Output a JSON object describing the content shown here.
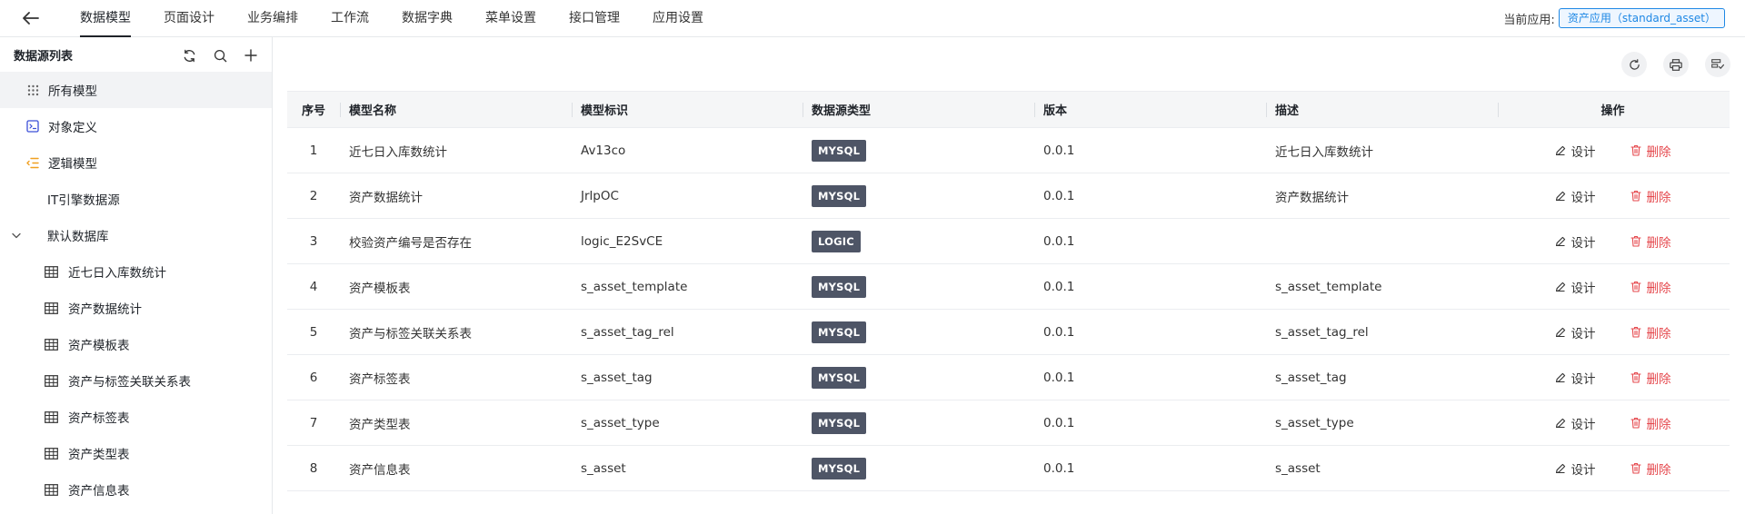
{
  "nav": {
    "tabs": [
      {
        "label": "数据模型",
        "active": true
      },
      {
        "label": "页面设计"
      },
      {
        "label": "业务编排"
      },
      {
        "label": "工作流"
      },
      {
        "label": "数据字典"
      },
      {
        "label": "菜单设置"
      },
      {
        "label": "接口管理"
      },
      {
        "label": "应用设置"
      }
    ],
    "current_app_label": "当前应用:",
    "current_app_value": "资产应用（standard_asset）"
  },
  "sidebar": {
    "title": "数据源列表",
    "items": [
      {
        "label": "所有模型",
        "icon": "grid-dots-icon",
        "selected": true
      },
      {
        "label": "对象定义",
        "icon": "object-icon"
      },
      {
        "label": "逻辑模型",
        "icon": "logic-list-icon"
      },
      {
        "label": "IT引擎数据源"
      },
      {
        "label": "默认数据库",
        "icon": "chevron-down-icon"
      },
      {
        "label": "近七日入库数统计",
        "icon": "table-icon"
      },
      {
        "label": "资产数据统计",
        "icon": "table-icon"
      },
      {
        "label": "资产模板表",
        "icon": "table-icon"
      },
      {
        "label": "资产与标签关联关系表",
        "icon": "table-icon"
      },
      {
        "label": "资产标签表",
        "icon": "table-icon"
      },
      {
        "label": "资产类型表",
        "icon": "table-icon"
      },
      {
        "label": "资产信息表",
        "icon": "table-icon"
      }
    ]
  },
  "table": {
    "headers": {
      "no": "序号",
      "name": "模型名称",
      "id": "模型标识",
      "type": "数据源类型",
      "version": "版本",
      "desc": "描述",
      "ops": "操作"
    },
    "design_label": "设计",
    "delete_label": "删除",
    "rows": [
      {
        "no": "1",
        "name": "近七日入库数统计",
        "id": "Av13co",
        "type": "MYSQL",
        "version": "0.0.1",
        "desc": "近七日入库数统计"
      },
      {
        "no": "2",
        "name": "资产数据统计",
        "id": "JrlpOC",
        "type": "MYSQL",
        "version": "0.0.1",
        "desc": "资产数据统计"
      },
      {
        "no": "3",
        "name": "校验资产编号是否存在",
        "id": "logic_E2SvCE",
        "type": "LOGIC",
        "version": "0.0.1",
        "desc": ""
      },
      {
        "no": "4",
        "name": "资产模板表",
        "id": "s_asset_template",
        "type": "MYSQL",
        "version": "0.0.1",
        "desc": "s_asset_template"
      },
      {
        "no": "5",
        "name": "资产与标签关联关系表",
        "id": "s_asset_tag_rel",
        "type": "MYSQL",
        "version": "0.0.1",
        "desc": "s_asset_tag_rel"
      },
      {
        "no": "6",
        "name": "资产标签表",
        "id": "s_asset_tag",
        "type": "MYSQL",
        "version": "0.0.1",
        "desc": "s_asset_tag"
      },
      {
        "no": "7",
        "name": "资产类型表",
        "id": "s_asset_type",
        "type": "MYSQL",
        "version": "0.0.1",
        "desc": "s_asset_type"
      },
      {
        "no": "8",
        "name": "资产信息表",
        "id": "s_asset",
        "type": "MYSQL",
        "version": "0.0.1",
        "desc": "s_asset"
      }
    ]
  },
  "colors": {
    "accent": "#1e88e5",
    "badge": "#4e5566",
    "danger": "#e5484d",
    "logic_icon": "#f0a020",
    "object_icon": "#3b4fd8"
  }
}
